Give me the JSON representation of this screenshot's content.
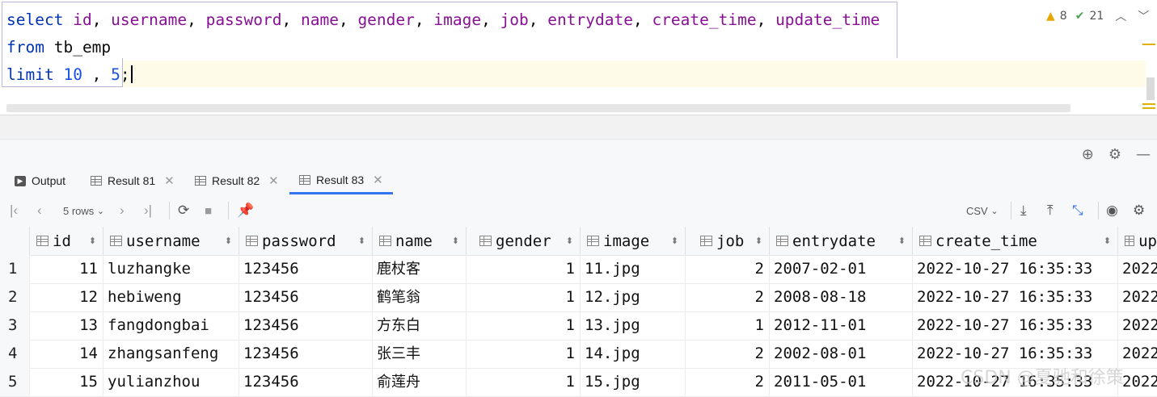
{
  "editor": {
    "line1": {
      "kw_select": "select",
      "columns": [
        "id",
        "username",
        "password",
        "name",
        "gender",
        "image",
        "job",
        "entrydate",
        "create_time",
        "update_time"
      ]
    },
    "line2": {
      "kw_from": "from",
      "table": "tb_emp"
    },
    "line3": {
      "kw_limit": "limit",
      "offset": "10",
      "comma": " , ",
      "count": "5",
      "semi": ";"
    },
    "inspections": {
      "warnings": "8",
      "ok": "21"
    }
  },
  "tabs": [
    {
      "label": "Output"
    },
    {
      "label": "Result 81"
    },
    {
      "label": "Result 82"
    },
    {
      "label": "Result 83"
    }
  ],
  "toolbar": {
    "rows_label": "5 rows",
    "export_format": "CSV"
  },
  "table": {
    "columns": [
      "id",
      "username",
      "password",
      "name",
      "gender",
      "image",
      "job",
      "entrydate",
      "create_time",
      "up"
    ],
    "rows": [
      {
        "n": "1",
        "id": "11",
        "username": "luzhangke",
        "password": "123456",
        "name": "鹿杖客",
        "gender": "1",
        "image": "11.jpg",
        "job": "2",
        "entrydate": "2007-02-01",
        "create_time": "2022-10-27 16:35:33",
        "update": "2022"
      },
      {
        "n": "2",
        "id": "12",
        "username": "hebiweng",
        "password": "123456",
        "name": "鹤笔翁",
        "gender": "1",
        "image": "12.jpg",
        "job": "2",
        "entrydate": "2008-08-18",
        "create_time": "2022-10-27 16:35:33",
        "update": "2022"
      },
      {
        "n": "3",
        "id": "13",
        "username": "fangdongbai",
        "password": "123456",
        "name": "方东白",
        "gender": "1",
        "image": "13.jpg",
        "job": "1",
        "entrydate": "2012-11-01",
        "create_time": "2022-10-27 16:35:33",
        "update": "2022"
      },
      {
        "n": "4",
        "id": "14",
        "username": "zhangsanfeng",
        "password": "123456",
        "name": "张三丰",
        "gender": "1",
        "image": "14.jpg",
        "job": "2",
        "entrydate": "2002-08-01",
        "create_time": "2022-10-27 16:35:33",
        "update": "2022"
      },
      {
        "n": "5",
        "id": "15",
        "username": "yulianzhou",
        "password": "123456",
        "name": "俞莲舟",
        "gender": "1",
        "image": "15.jpg",
        "job": "2",
        "entrydate": "2011-05-01",
        "create_time": "2022-10-27 16:35:33",
        "update": "2022"
      }
    ]
  },
  "watermark": "CSDN @夏驰和徐策",
  "colors": {
    "keyword": "#0033b3",
    "column": "#871094",
    "number": "#1750eb",
    "active_tab": "#3574f0"
  }
}
